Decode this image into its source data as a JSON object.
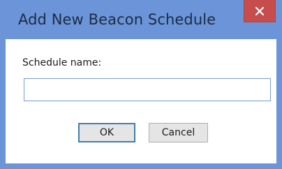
{
  "dialog": {
    "title": "Add New Beacon Schedule",
    "close_icon": "close-x-icon",
    "accent_color": "#6b95d8",
    "close_button_color": "#c74d4d"
  },
  "form": {
    "schedule_name_label": "Schedule name:",
    "schedule_name_value": "",
    "schedule_name_placeholder": ""
  },
  "buttons": {
    "ok_label": "OK",
    "cancel_label": "Cancel"
  }
}
